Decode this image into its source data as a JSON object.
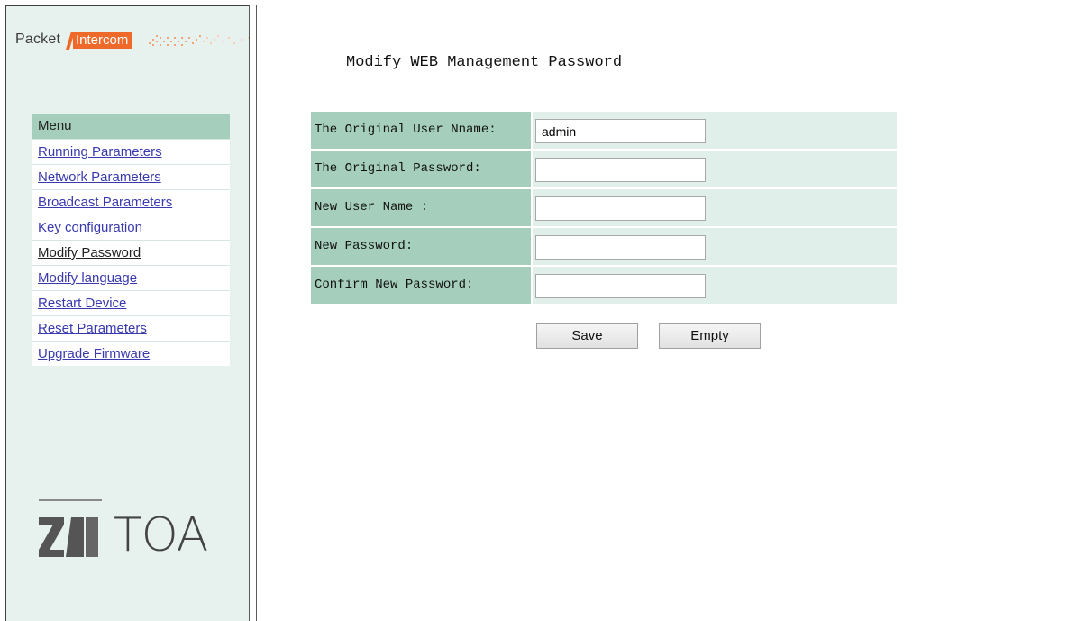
{
  "brand": {
    "packet": "Packet",
    "intercom": "Intercom",
    "toa_logo": "TOA",
    "accent_color": "#ef6a2a",
    "menu_header_color": "#a5cfbc"
  },
  "sidebar": {
    "menu_title": "Menu",
    "items": [
      {
        "label": "Running Parameters",
        "active": false
      },
      {
        "label": "Network Parameters",
        "active": false
      },
      {
        "label": "Broadcast Parameters",
        "active": false
      },
      {
        "label": "Key configuration",
        "active": false
      },
      {
        "label": "Modify Password",
        "active": true
      },
      {
        "label": "Modify language",
        "active": false
      },
      {
        "label": "Restart Device",
        "active": false
      },
      {
        "label": "Reset Parameters",
        "active": false
      },
      {
        "label": "Upgrade Firmware",
        "active": false
      }
    ]
  },
  "main": {
    "title": "Modify WEB Management Password",
    "fields": [
      {
        "label": "The Original User Nname:",
        "value": ""
      },
      {
        "label": "The Original Password:",
        "value": ""
      },
      {
        "label": "New User Name :",
        "value": ""
      },
      {
        "label": "New Password:",
        "value": ""
      },
      {
        "label": "Confirm New Password:",
        "value": ""
      }
    ],
    "original_user_value": "admin",
    "save_label": "Save",
    "empty_label": "Empty"
  }
}
